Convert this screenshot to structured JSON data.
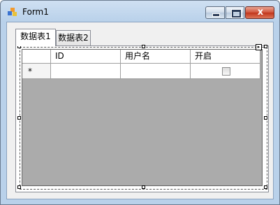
{
  "window": {
    "title": "Form1",
    "close_glyph": "x",
    "icon": "app-icon"
  },
  "tabs": [
    {
      "label": "数据表1",
      "selected": true
    },
    {
      "label": "数据表2",
      "selected": false
    }
  ],
  "grid": {
    "columns": [
      "ID",
      "用户名",
      "开启"
    ],
    "new_row_marker": "*",
    "new_row": {
      "id": "",
      "username": "",
      "enabled": false
    },
    "background_color": "#ababab"
  }
}
